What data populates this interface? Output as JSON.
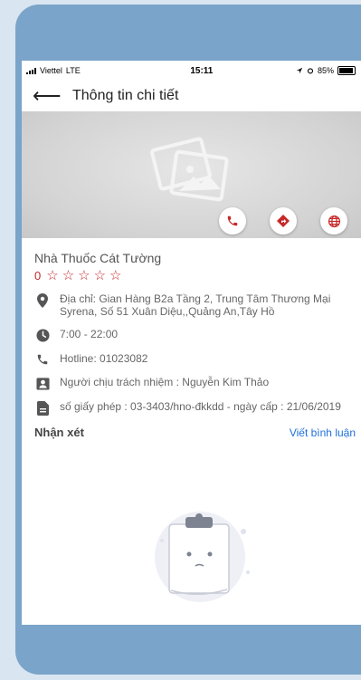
{
  "status_bar": {
    "carrier": "Viettel",
    "network": "LTE",
    "time": "15:11",
    "battery": "85%"
  },
  "header": {
    "title": "Thông tin chi tiết"
  },
  "store": {
    "name": "Nhà Thuốc Cát Tường",
    "rating": "0",
    "stars": [
      "☆",
      "☆",
      "☆",
      "☆",
      "☆"
    ],
    "address": "Địa chỉ: Gian Hàng B2a Tầng 2, Trung Tâm Thương Mại Syrena, Số 51 Xuân Diệu,,Quảng An,Tây Hồ",
    "hours": "7:00 - 22:00",
    "hotline": "Hotline: 01023082",
    "responsible": "Người chịu trách nhiệm : Nguyễn Kim Thảo",
    "license": "số giấy phép : 03-3403/hno-đkkdd - ngày cấp : 21/06/2019"
  },
  "reviews": {
    "title": "Nhận xét",
    "write_link": "Viết bình luận"
  },
  "colors": {
    "accent": "#c62828",
    "link": "#1e6fd9",
    "frame": "#7aa4c9"
  }
}
